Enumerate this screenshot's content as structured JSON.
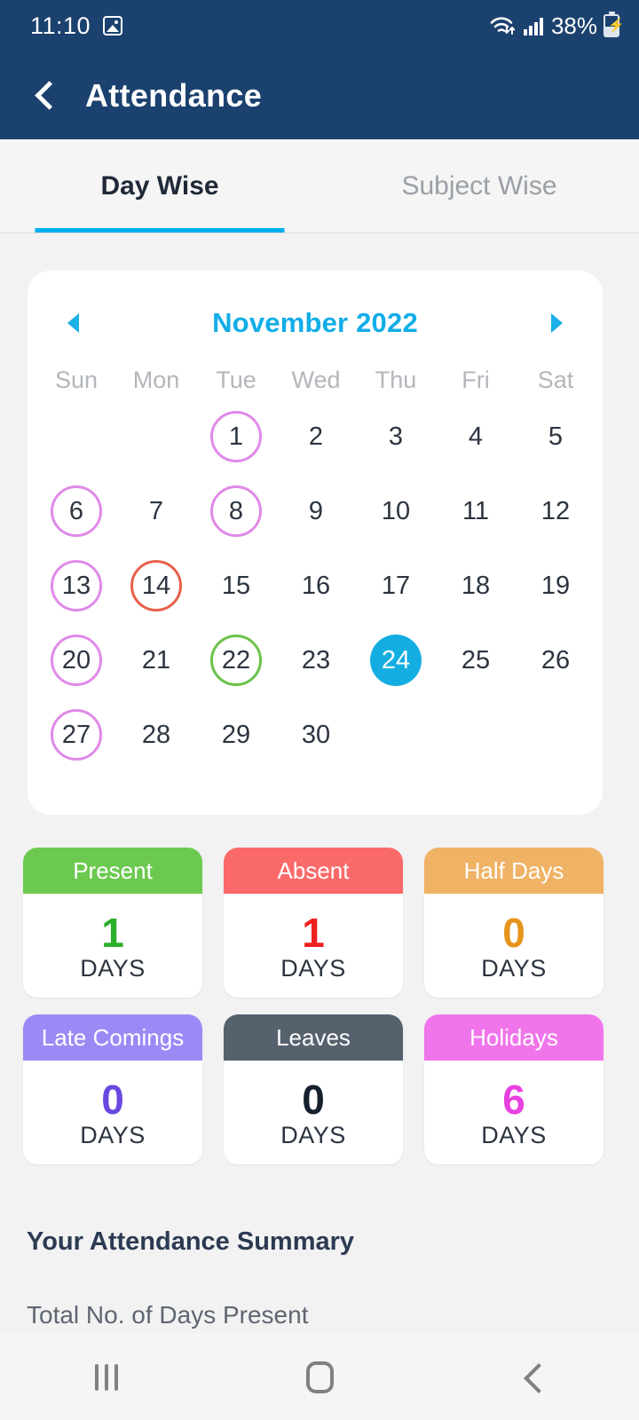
{
  "status_bar": {
    "time": "11:10",
    "battery_percent": "38%",
    "icons": [
      "image-icon",
      "wifi-icon",
      "cellular-signal-icon",
      "battery-charging-icon"
    ]
  },
  "app_bar": {
    "title": "Attendance",
    "back_icon": "back-chevron-icon"
  },
  "tabs": [
    {
      "label": "Day Wise",
      "active": true
    },
    {
      "label": "Subject Wise",
      "active": false
    }
  ],
  "calendar": {
    "title": "November 2022",
    "prev_icon": "chevron-left-icon",
    "next_icon": "chevron-right-icon",
    "accent_color": "#11ade6",
    "weekdays": [
      "Sun",
      "Mon",
      "Tue",
      "Wed",
      "Thu",
      "Fri",
      "Sat"
    ],
    "legend_colors": {
      "holiday": "#e08ae8",
      "absent": "#e8604b",
      "present": "#6cc24a",
      "today": "#14ade2"
    },
    "weeks": [
      [
        {
          "day": "",
          "state": "empty"
        },
        {
          "day": "",
          "state": "empty"
        },
        {
          "day": "1",
          "state": "holiday"
        },
        {
          "day": "2",
          "state": "none"
        },
        {
          "day": "3",
          "state": "none"
        },
        {
          "day": "4",
          "state": "none"
        },
        {
          "day": "5",
          "state": "none"
        }
      ],
      [
        {
          "day": "6",
          "state": "holiday"
        },
        {
          "day": "7",
          "state": "none"
        },
        {
          "day": "8",
          "state": "holiday"
        },
        {
          "day": "9",
          "state": "none"
        },
        {
          "day": "10",
          "state": "none"
        },
        {
          "day": "11",
          "state": "none"
        },
        {
          "day": "12",
          "state": "none"
        }
      ],
      [
        {
          "day": "13",
          "state": "holiday"
        },
        {
          "day": "14",
          "state": "absent"
        },
        {
          "day": "15",
          "state": "none"
        },
        {
          "day": "16",
          "state": "none"
        },
        {
          "day": "17",
          "state": "none"
        },
        {
          "day": "18",
          "state": "none"
        },
        {
          "day": "19",
          "state": "none"
        }
      ],
      [
        {
          "day": "20",
          "state": "holiday"
        },
        {
          "day": "21",
          "state": "none"
        },
        {
          "day": "22",
          "state": "present"
        },
        {
          "day": "23",
          "state": "none"
        },
        {
          "day": "24",
          "state": "today"
        },
        {
          "day": "25",
          "state": "none"
        },
        {
          "day": "26",
          "state": "none"
        }
      ],
      [
        {
          "day": "27",
          "state": "holiday"
        },
        {
          "day": "28",
          "state": "none"
        },
        {
          "day": "29",
          "state": "none"
        },
        {
          "day": "30",
          "state": "none"
        },
        {
          "day": "",
          "state": "empty"
        },
        {
          "day": "",
          "state": "empty"
        },
        {
          "day": "",
          "state": "empty"
        }
      ]
    ]
  },
  "stats": [
    [
      {
        "label": "Present",
        "value": "1",
        "unit": "DAYS",
        "header_color": "#6cc94f",
        "value_color": "#2cb02c"
      },
      {
        "label": "Absent",
        "value": "1",
        "unit": "DAYS",
        "header_color": "#fb6a6a",
        "value_color": "#f02020"
      },
      {
        "label": "Half Days",
        "value": "0",
        "unit": "DAYS",
        "header_color": "#f0b265",
        "value_color": "#e5941c"
      }
    ],
    [
      {
        "label": "Late Comings",
        "value": "0",
        "unit": "DAYS",
        "header_color": "#9b8af5",
        "value_color": "#6a47e0"
      },
      {
        "label": "Leaves",
        "value": "0",
        "unit": "DAYS",
        "header_color": "#56616e",
        "value_color": "#17202e"
      },
      {
        "label": "Holidays",
        "value": "6",
        "unit": "DAYS",
        "header_color": "#f075ea",
        "value_color": "#e841e0"
      }
    ]
  ],
  "summary": {
    "title": "Your Attendance Summary",
    "first_row_label": "Total No. of Days Present"
  },
  "nav_bar": {
    "recents_icon": "recents-icon",
    "home_icon": "home-icon",
    "back_icon": "back-icon"
  }
}
